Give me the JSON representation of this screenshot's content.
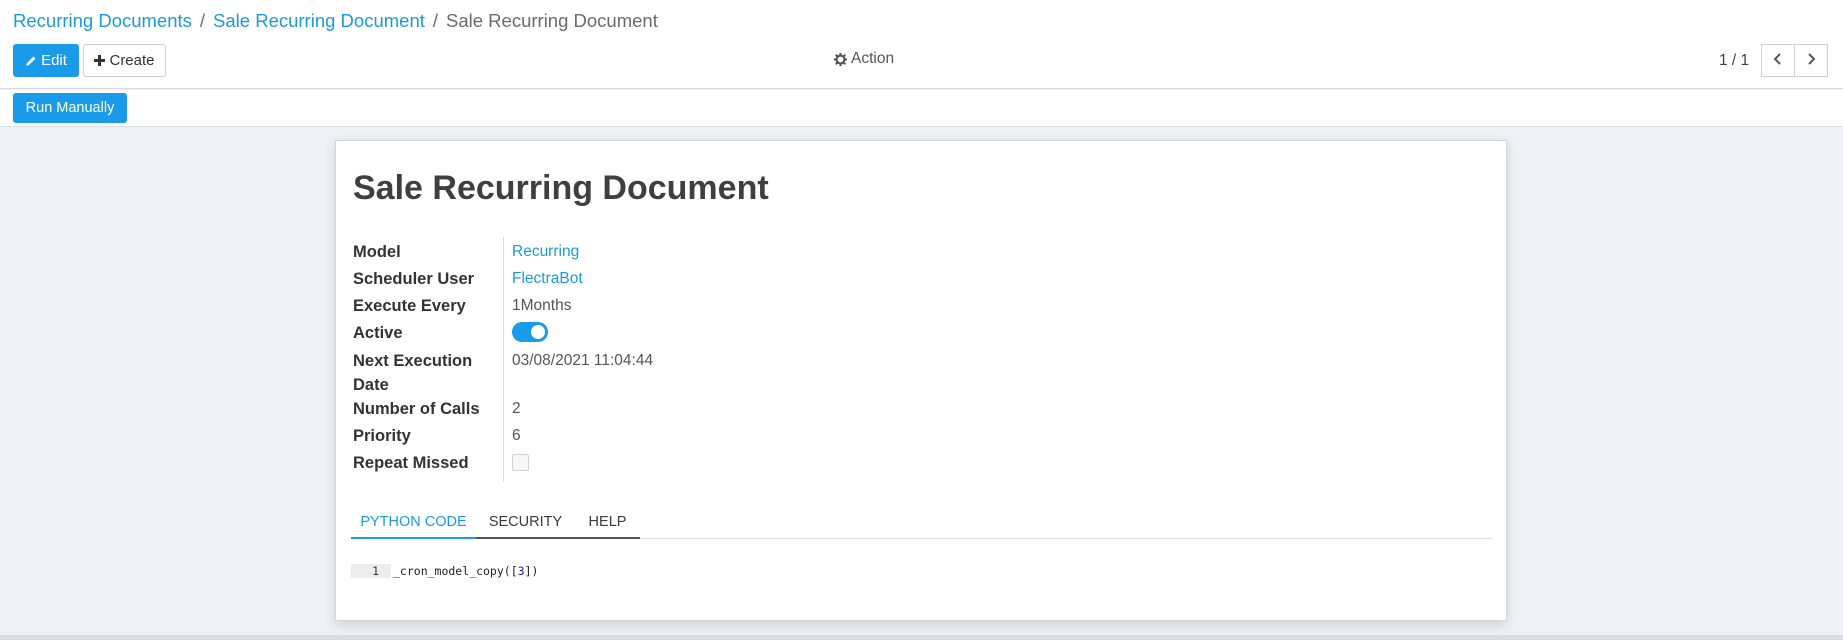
{
  "breadcrumb": {
    "items": [
      "Recurring Documents",
      "Sale Recurring Document"
    ],
    "current": "Sale Recurring Document",
    "separator": "/"
  },
  "toolbar": {
    "edit_label": "Edit",
    "create_label": "Create",
    "action_label": "Action",
    "pager": "1 / 1"
  },
  "statusbar": {
    "run_manually_label": "Run Manually"
  },
  "form": {
    "title": "Sale Recurring Document",
    "fields": {
      "model": {
        "label": "Model",
        "value": "Recurring"
      },
      "scheduler_user": {
        "label": "Scheduler User",
        "value": "FlectraBot"
      },
      "execute_every": {
        "label": "Execute Every",
        "value": "1Months"
      },
      "active": {
        "label": "Active",
        "value": true
      },
      "next_execution_date": {
        "label_line1": "Next Execution",
        "label_line2": "Date",
        "value": "03/08/2021 11:04:44"
      },
      "number_of_calls": {
        "label": "Number of Calls",
        "value": "2"
      },
      "priority": {
        "label": "Priority",
        "value": "6"
      },
      "repeat_missed": {
        "label": "Repeat Missed",
        "value": false
      }
    },
    "tabs": [
      {
        "label": "PYTHON CODE",
        "active": true
      },
      {
        "label": "SECURITY",
        "active": false
      },
      {
        "label": "HELP",
        "active": false
      }
    ],
    "code": {
      "line_number": "1",
      "prefix": "_cron_model_copy([",
      "number": "3",
      "suffix": "])"
    }
  },
  "colors": {
    "primary": "#1a9be9",
    "link": "#1a9bd9",
    "background": "#eef2f6"
  },
  "icons": {
    "edit": "pencil-icon",
    "create": "plus-icon",
    "action": "gear-icon",
    "pager_prev": "chevron-left-icon",
    "pager_next": "chevron-right-icon"
  }
}
